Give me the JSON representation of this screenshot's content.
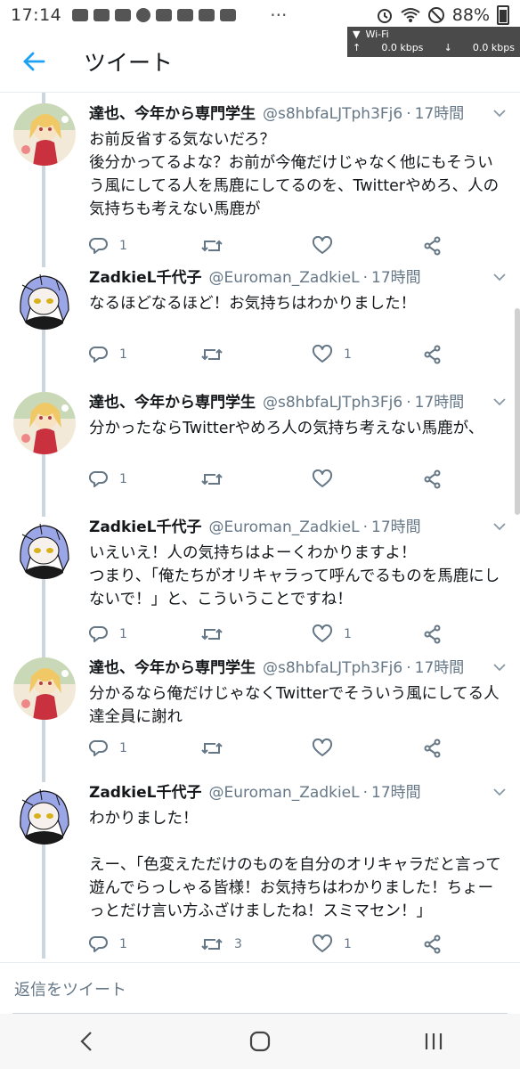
{
  "statusbar": {
    "time": "17:14",
    "dots": "···",
    "battery_text": "88%"
  },
  "wifi": {
    "label": "Wi-Fi",
    "up_arrow": "↑",
    "up_rate": "0.0 kbps",
    "down_arrow": "↓",
    "down_rate": "0.0 kbps"
  },
  "header": {
    "title": "ツイート"
  },
  "colors": {
    "accent": "#1da1f2",
    "text": "#14171a",
    "secondary": "#657786",
    "thread_line": "#ccd6dd"
  },
  "tweets": [
    {
      "name": "達也、今年から専門学生",
      "handle": "@s8hbfaLJTph3Fj6",
      "sep": "·",
      "time": "17時間",
      "text": "お前反省する気ないだろ？\n後分かってるよな？お前が今俺だけじゃなく他にもそういう風にしてる人を馬鹿にしてるのを、Twitterやめろ、人の気持ちも考えない馬鹿が",
      "replies": "1",
      "retweets": "",
      "likes": ""
    },
    {
      "name": "ZadkieL千代子",
      "handle": "@Euroman_ZadkieL",
      "sep": "·",
      "time": "17時間",
      "text": "なるほどなるほど！お気持ちはわかりました！",
      "replies": "1",
      "retweets": "",
      "likes": "1"
    },
    {
      "name": "達也、今年から専門学生",
      "handle": "@s8hbfaLJTph3Fj6",
      "sep": "·",
      "time": "17時間",
      "text": "分かったならTwitterやめろ人の気持ち考えない馬鹿が、",
      "replies": "1",
      "retweets": "",
      "likes": ""
    },
    {
      "name": "ZadkieL千代子",
      "handle": "@Euroman_ZadkieL",
      "sep": "·",
      "time": "17時間",
      "text": "いえいえ！人の気持ちはよーくわかりますよ！\nつまり、「俺たちがオリキャラって呼んでるものを馬鹿にしないで！」と、こういうことですね！",
      "replies": "1",
      "retweets": "",
      "likes": "1"
    },
    {
      "name": "達也、今年から専門学生",
      "handle": "@s8hbfaLJTph3Fj6",
      "sep": "·",
      "time": "17時間",
      "text": "分かるなら俺だけじゃなくTwitterでそういう風にしてる人達全員に謝れ",
      "replies": "1",
      "retweets": "",
      "likes": ""
    },
    {
      "name": "ZadkieL千代子",
      "handle": "@Euroman_ZadkieL",
      "sep": "·",
      "time": "17時間",
      "text": "わかりました！\n\nえー、「色変えただけのものを自分のオリキャラだと言って遊んでらっしゃる皆様！お気持ちはわかりました！ちょーっとだけ言い方ふざけましたね！スミマセン！」",
      "replies": "1",
      "retweets": "3",
      "likes": "1"
    }
  ],
  "reply_bar": {
    "placeholder": "返信をツイート"
  }
}
